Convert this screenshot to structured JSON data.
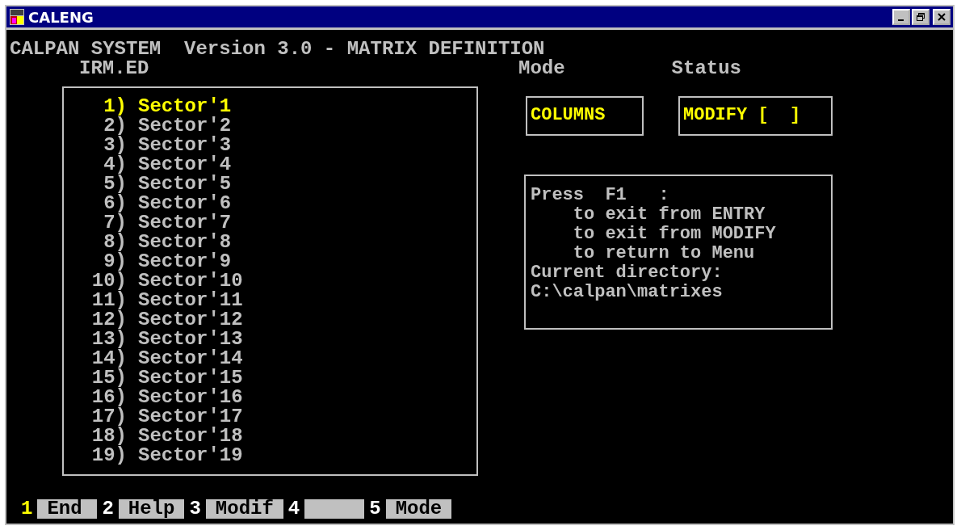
{
  "window": {
    "title": "CALENG"
  },
  "header": "CALPAN SYSTEM  Version 3.0 - MATRIX DEFINITION",
  "file_name": "IRM.ED",
  "mode": {
    "label": "Mode",
    "value": "COLUMNS"
  },
  "status": {
    "label": "Status",
    "value": "MODIFY [  ]"
  },
  "sectors": [
    {
      "number": "1)",
      "label": "Sector'1",
      "selected": true
    },
    {
      "number": "2)",
      "label": "Sector'2",
      "selected": false
    },
    {
      "number": "3)",
      "label": "Sector'3",
      "selected": false
    },
    {
      "number": "4)",
      "label": "Sector'4",
      "selected": false
    },
    {
      "number": "5)",
      "label": "Sector'5",
      "selected": false
    },
    {
      "number": "6)",
      "label": "Sector'6",
      "selected": false
    },
    {
      "number": "7)",
      "label": "Sector'7",
      "selected": false
    },
    {
      "number": "8)",
      "label": "Sector'8",
      "selected": false
    },
    {
      "number": "9)",
      "label": "Sector'9",
      "selected": false
    },
    {
      "number": "10)",
      "label": "Sector'10",
      "selected": false
    },
    {
      "number": "11)",
      "label": "Sector'11",
      "selected": false
    },
    {
      "number": "12)",
      "label": "Sector'12",
      "selected": false
    },
    {
      "number": "13)",
      "label": "Sector'13",
      "selected": false
    },
    {
      "number": "14)",
      "label": "Sector'14",
      "selected": false
    },
    {
      "number": "15)",
      "label": "Sector'15",
      "selected": false
    },
    {
      "number": "16)",
      "label": "Sector'16",
      "selected": false
    },
    {
      "number": "17)",
      "label": "Sector'17",
      "selected": false
    },
    {
      "number": "18)",
      "label": "Sector'18",
      "selected": false
    },
    {
      "number": "19)",
      "label": "Sector'19",
      "selected": false
    }
  ],
  "help": {
    "lines": [
      "Press  F1   :",
      "    to exit from ENTRY",
      "    to exit from MODIFY",
      "    to return to Menu",
      "Current directory:",
      "C:\\calpan\\matrixes"
    ]
  },
  "function_keys": [
    {
      "key": "1",
      "label": "End",
      "selected": true
    },
    {
      "key": "2",
      "label": "Help",
      "selected": false
    },
    {
      "key": "3",
      "label": "Modif",
      "selected": false
    },
    {
      "key": "4",
      "selected": false
    },
    {
      "key": "5",
      "label": "Mode",
      "selected": false
    }
  ]
}
